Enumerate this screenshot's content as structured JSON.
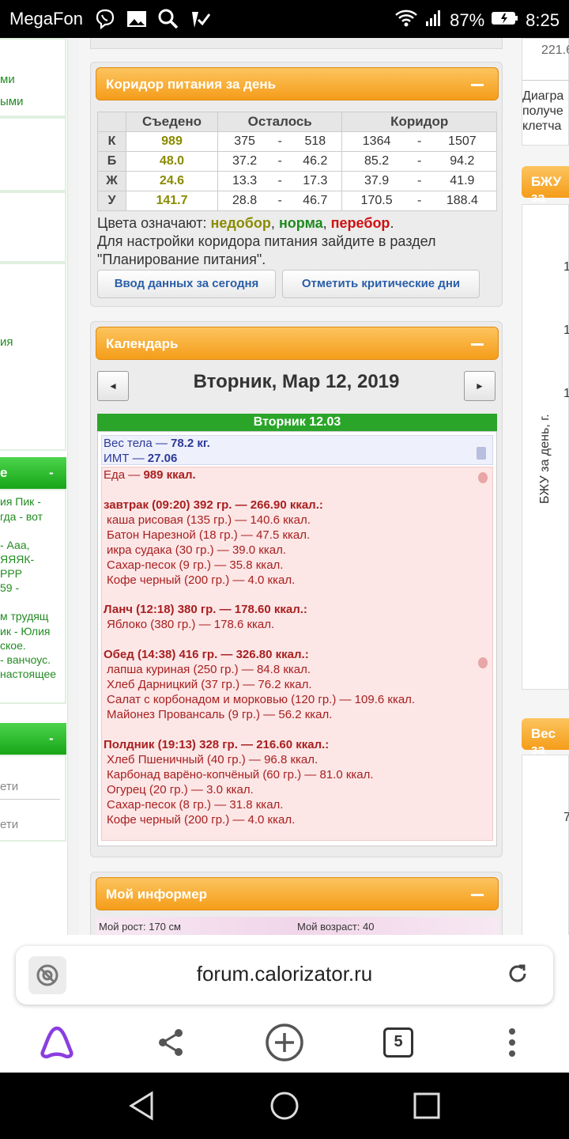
{
  "status_bar": {
    "carrier": "MegaFon",
    "battery": "87%",
    "time": "8:25"
  },
  "left_column": {
    "items_top": [
      "ми",
      "ыми"
    ],
    "item_mid": "ия",
    "box1_title": "е",
    "box1_minus": "-",
    "box1_lines": [
      "ия Пик -",
      "гда - вот",
      "",
      "- Ааа,",
      "ЯЯЯК-",
      "РРР",
      "59 -",
      "",
      "м трудящ",
      "ик - Юлия",
      "ское.",
      "- ванчоус.",
      "настоящее"
    ],
    "box2_minus": "-",
    "box2_lines": [
      "ети",
      "ети"
    ]
  },
  "corridor": {
    "title": "Коридор питания за день",
    "headers": [
      "Съедено",
      "Осталось",
      "Коридор"
    ],
    "rows": [
      {
        "label": "К",
        "eaten": "989",
        "rem_min": "375",
        "rem_max": "518",
        "cor_min": "1364",
        "cor_max": "1507"
      },
      {
        "label": "Б",
        "eaten": "48.0",
        "rem_min": "37.2",
        "rem_max": "46.2",
        "cor_min": "85.2",
        "cor_max": "94.2"
      },
      {
        "label": "Ж",
        "eaten": "24.6",
        "rem_min": "13.3",
        "rem_max": "17.3",
        "cor_min": "37.9",
        "cor_max": "41.9"
      },
      {
        "label": "У",
        "eaten": "141.7",
        "rem_min": "28.8",
        "rem_max": "46.7",
        "cor_min": "170.5",
        "cor_max": "188.4"
      }
    ],
    "dash": "-",
    "legend_prefix": "Цвета означают: ",
    "legend_short": "недобор",
    "legend_sep1": ", ",
    "legend_norm": "норма",
    "legend_sep2": ", ",
    "legend_over": "перебор",
    "legend_end": ".",
    "note_line1": "Для настройки коридора питания зайдите в раздел",
    "note_line2": "\"Планирование питания\".",
    "btn_input": "Ввод данных за сегодня",
    "btn_critical": "Отметить критические дни",
    "colors": {
      "short": "#8b8b00",
      "norm": "#1e8a1e",
      "over": "#d01010"
    }
  },
  "calendar": {
    "title": "Календарь",
    "prev": "◄",
    "next": "►",
    "date": "Вторник, Мар 12, 2019",
    "day_bar": "Вторник 12.03",
    "weight_label": "Вес тела — ",
    "weight_value": "78.2 кг.",
    "bmi_label": "ИМТ — ",
    "bmi_value": "27.06",
    "food_label": "Еда — ",
    "food_value": "989 ккал.",
    "meals": [
      {
        "header": "завтрак (09:20) 392 гр. — 266.90 ккал.:",
        "items": [
          "каша рисовая (135 гр.) — 140.6 ккал.",
          "Батон Нарезной (18 гр.) — 47.5 ккал.",
          "икра судака (30 гр.) — 39.0 ккал.",
          "Сахар-песок (9 гр.) — 35.8 ккал.",
          "Кофе черный (200 гр.) — 4.0 ккал."
        ]
      },
      {
        "header": "Ланч (12:18) 380 гр. — 178.60 ккал.:",
        "items": [
          "Яблоко (380 гр.) — 178.6 ккал."
        ]
      },
      {
        "header": "Обед (14:38) 416 гр. — 326.80 ккал.:",
        "items": [
          "лапша куриная (250 гр.) — 84.8 ккал.",
          "Хлеб Дарницкий (37 гр.) — 76.2 ккал.",
          "Салат с корбонадом и морковью (120 гр.) — 109.6 ккал.",
          "Майонез Провансаль (9 гр.) — 56.2 ккал."
        ]
      },
      {
        "header": "Полдник (19:13) 328 гр. — 216.60 ккал.:",
        "items": [
          "Хлеб Пшеничный (40 гр.) — 96.8 ккал.",
          "Карбонад варёно-копчёный (60 гр.) — 81.0 ккал.",
          "Огурец (20 гр.) — 3.0 ккал.",
          "Сахар-песок (8 гр.) — 31.8 ккал.",
          "Кофе черный (200 гр.) — 4.0 ккал."
        ]
      }
    ]
  },
  "informer": {
    "title": "Мой информер",
    "height_text": "Мой рост: 170 см",
    "age_text": "Мой возраст: 40"
  },
  "right_column": {
    "top_value": "221.6",
    "top_lines": [
      "Диагра",
      "получе",
      "клетча"
    ],
    "bzhu_title": "БЖУ за",
    "axis_label": "БЖУ за день, г.",
    "ticks": [
      "1",
      "1",
      "1"
    ],
    "weight_title": "Вес за",
    "weight_tick": "7"
  },
  "browser": {
    "url": "forum.calorizator.ru",
    "tabs_count": "5"
  }
}
